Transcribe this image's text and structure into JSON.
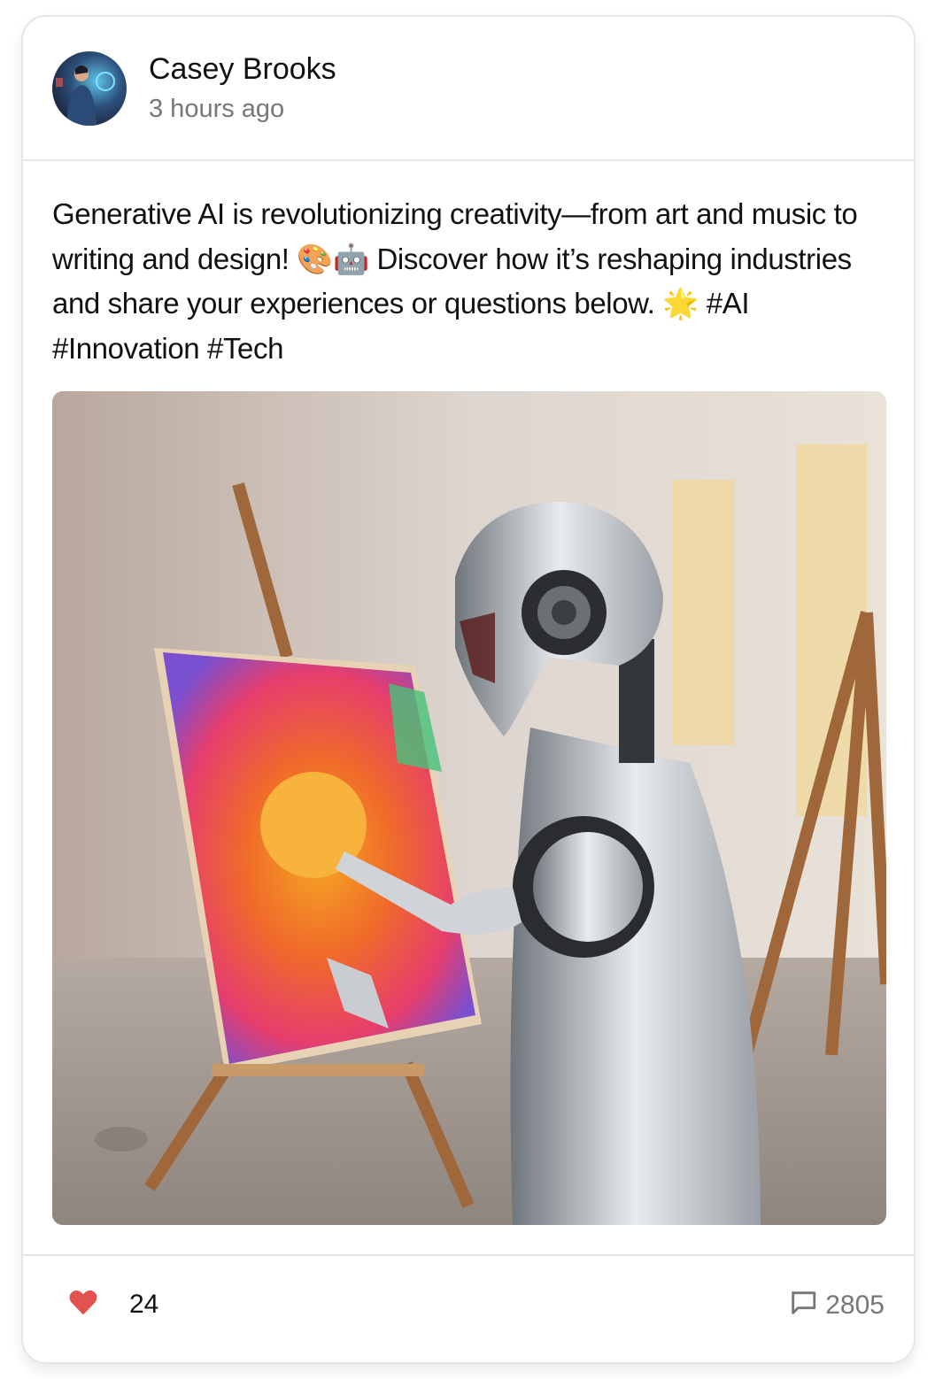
{
  "post": {
    "author": "Casey Brooks",
    "timestamp": "3 hours ago",
    "text": "Generative AI is revolutionizing creativity—from art and music to writing and design! 🎨🤖 Discover how it’s reshaping industries and share your experiences or questions below. 🌟 #AI #Innovation #Tech",
    "likes": "24",
    "comments": "2805",
    "liked": true
  },
  "colors": {
    "heart": "#e0534f",
    "muted": "#777777",
    "border": "#e6e6e6"
  },
  "icons": {
    "like": "heart-icon",
    "comment": "comment-icon"
  }
}
